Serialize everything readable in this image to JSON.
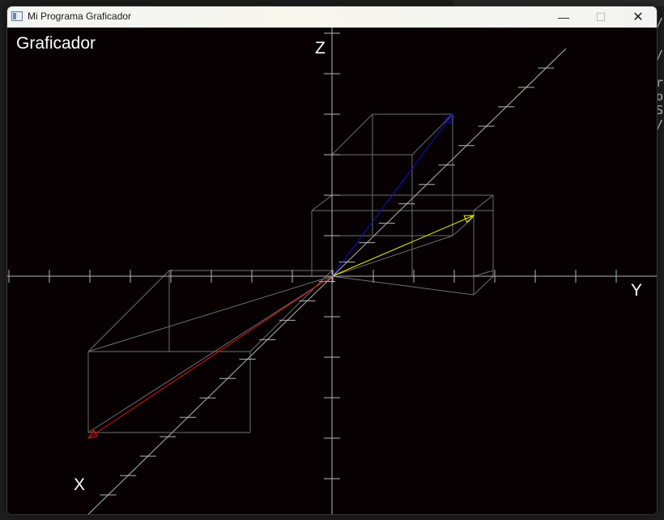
{
  "window": {
    "title": "Mi Programa Graficador",
    "controls": {
      "minimize": "—",
      "maximize": "☐",
      "close": "✕"
    },
    "icon": "app-window-icon"
  },
  "canvas": {
    "heading": "Graficador",
    "axes": {
      "x_label": "X",
      "y_label": "Y",
      "z_label": "Z"
    },
    "colors": {
      "background": "#060002",
      "axis": "#b4b4b4",
      "guide": "#6e6e6e",
      "vector_x": "#e01010",
      "vector_y": "#f0f000",
      "vector_z": "#1010d0"
    },
    "vectors": [
      {
        "name": "red-vector",
        "color": "#e01010"
      },
      {
        "name": "yellow-vector",
        "color": "#f0f000"
      },
      {
        "name": "blue-vector",
        "color": "#1010d0"
      }
    ]
  },
  "background": {
    "code_fragments": [
      "/p",
      "/p",
      "re",
      "ou",
      "SD",
      "/p"
    ]
  }
}
